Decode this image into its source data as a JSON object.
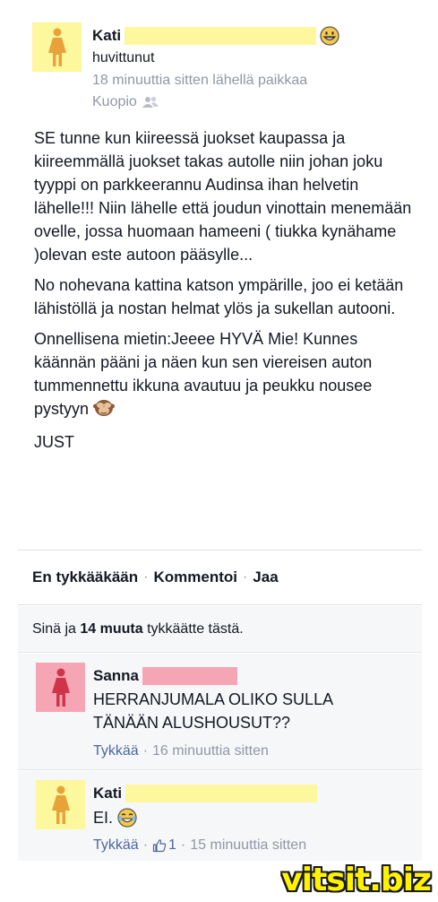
{
  "post": {
    "author": "Kati",
    "feeling": "huvittunut",
    "time": "18 minuuttia sitten lähellä paikkaa",
    "place": "Kuopio",
    "paragraphs": [
      "SE tunne kun kiireessä juokset kaupassa ja kiireemmällä juokset takas autolle niin johan joku tyyppi on parkkeerannu Audinsa ihan helvetin lähelle!!! Niin lähelle että joudun vinottain menemään ovelle, jossa huomaan hameeni ( tiukka kynähame )olevan este autoon pääsylle...",
      "No nohevana kattina katson ympärille, joo ei ketään lähistöllä ja nostan helmat ylös ja sukellan autooni.",
      "Onnellisena mietin:Jeeee HYVÄ Mie! Kunnes käännän pääni ja näen kun sen viereisen auton tummennettu ikkuna avautuu ja peukku nousee pystyyn",
      "JUST"
    ]
  },
  "actions": {
    "like": "En tykkääkään",
    "comment": "Kommentoi",
    "share": "Jaa",
    "separator": "·"
  },
  "likes": {
    "prefix": "Sinä ja",
    "count": "14 muuta",
    "suffix": "tykkäätte tästä."
  },
  "comments": [
    {
      "author": "Sanna",
      "text": "HERRANJUMALA OLIKO SULLA TÄNÄÄN ALUSHOUSUT??",
      "like_label": "Tykkää",
      "time": "16 minuuttia sitten"
    },
    {
      "author": "Kati",
      "text": "EI.",
      "like_label": "Tykkää",
      "like_count": "1",
      "time": "15 minuuttia sitten"
    }
  ],
  "watermark": "vitsit.biz",
  "icons": {
    "avatar_female": "female-silhouette-icon",
    "grin": "grinning-face-icon",
    "friends": "friends-icon",
    "monkey": "see-no-evil-monkey-icon",
    "joy": "tears-of-joy-icon",
    "thumb": "thumbs-up-icon"
  },
  "colors": {
    "yellow_avatar": "#fdf79e",
    "pink_avatar": "#f6a5b4",
    "figure_orange": "#e8a23a",
    "figure_red": "#d0344a",
    "meta_gray": "#9197a3",
    "link_blue": "#4b67a1",
    "watermark_yellow": "#fff200"
  }
}
